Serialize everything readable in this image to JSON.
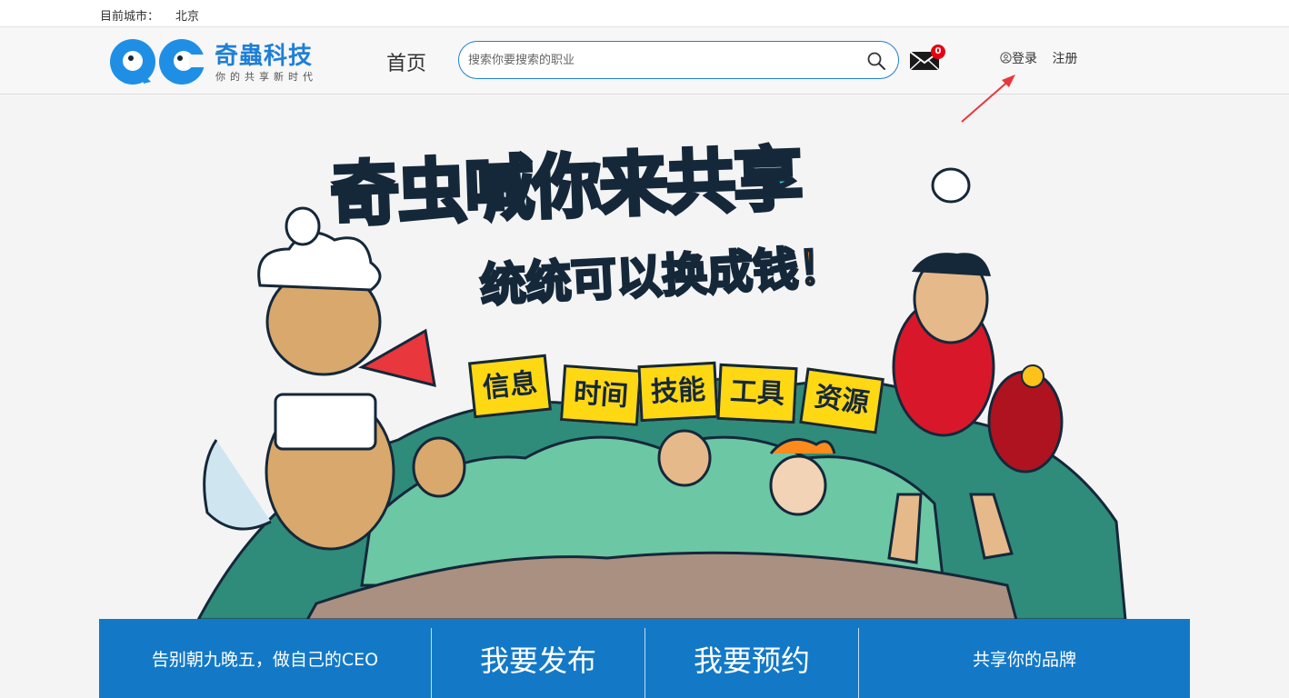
{
  "topbar": {
    "city_label": "目前城市：",
    "city_value": "北京"
  },
  "header": {
    "logo_brand": "奇蟲科技",
    "logo_slogan": "你的共享新时代",
    "nav_home": "首页",
    "search_placeholder": "搜索你要搜索的职业",
    "mail_count": "0",
    "login_label": "登录",
    "register_label": "注册"
  },
  "banner": {
    "title_line1": "奇虫喊你来共享",
    "title_line2_a": "统统可以",
    "title_line2_b": "换成钱！",
    "signs": [
      "信息",
      "时间",
      "技能",
      "工具",
      "资源"
    ]
  },
  "bottom_bar": {
    "slogan": "告别朝九晚五，做自己的CEO",
    "publish": "我要发布",
    "reserve": "我要预约",
    "brand": "共享你的品牌"
  },
  "colors": {
    "accent": "#1f7fd6",
    "bar": "#1379c7",
    "badge": "#e60012",
    "arrow": "#e8383d"
  }
}
